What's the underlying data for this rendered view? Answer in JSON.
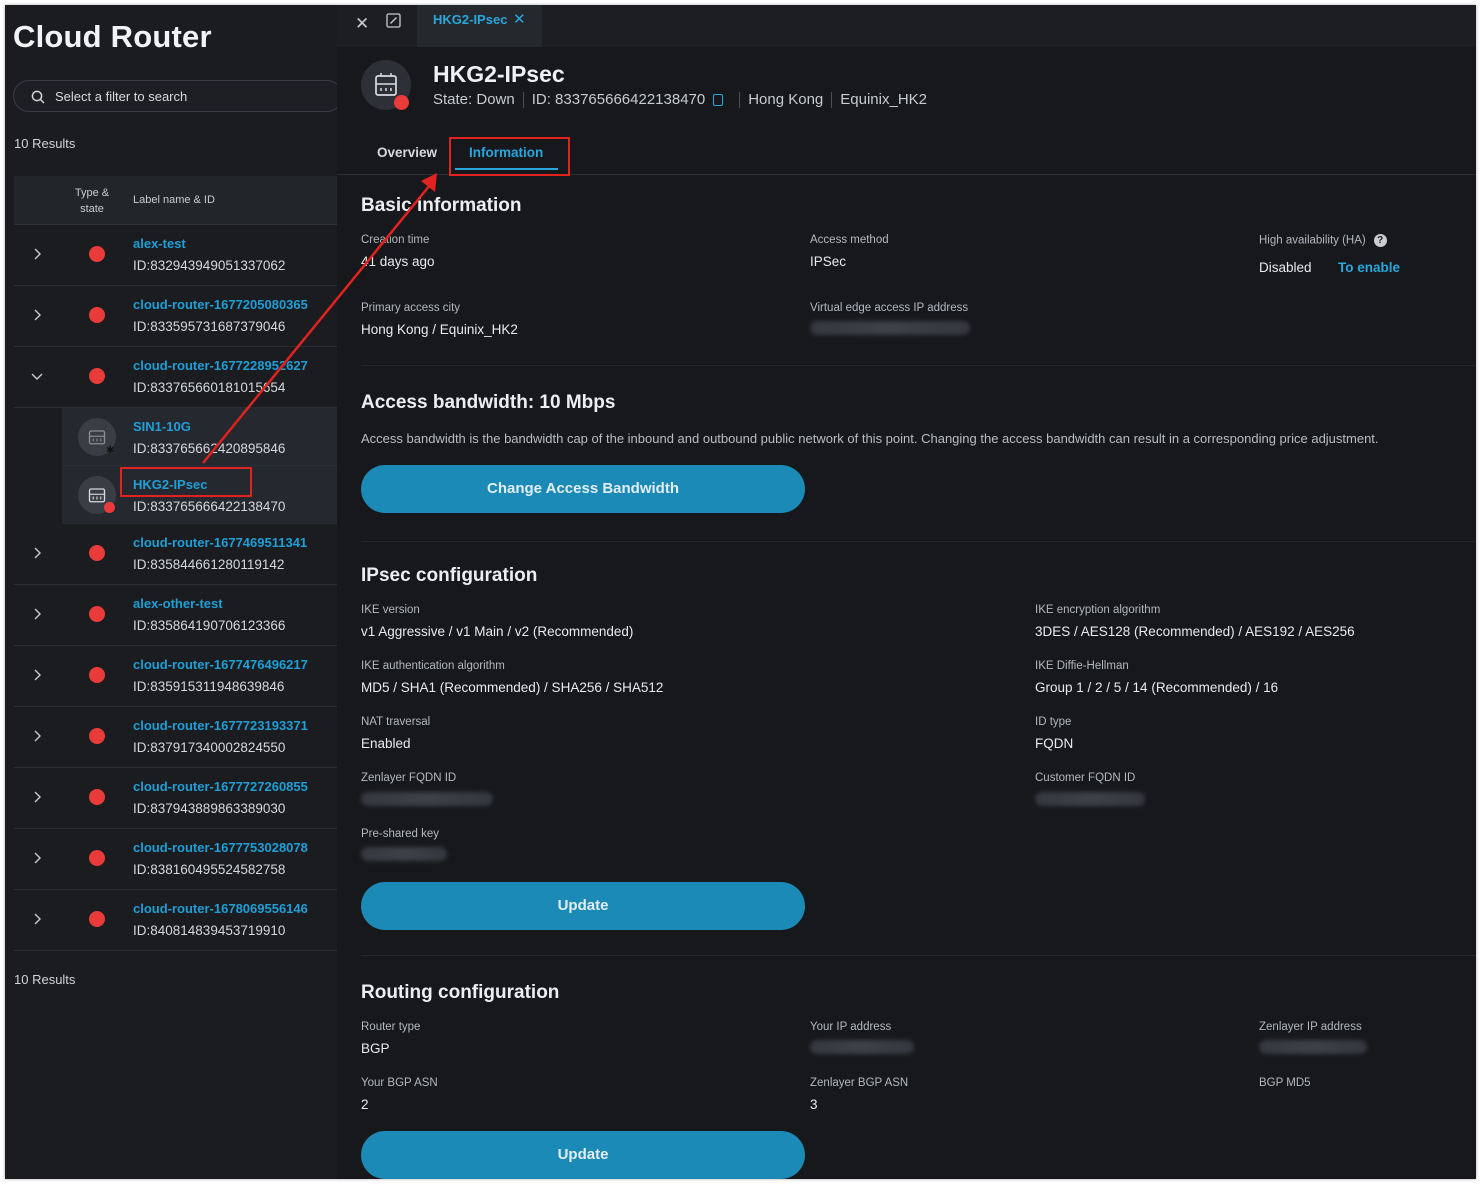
{
  "sidebar": {
    "title": "Cloud Router",
    "search_placeholder": "Select a filter to search",
    "results_top": "10 Results",
    "results_bottom": "10 Results",
    "columns": {
      "type_state": "Type & state",
      "label": "Label name & ID"
    },
    "rows": [
      {
        "name": "alex-test",
        "id": "ID:832943949051337062",
        "state": "down",
        "expanded": false
      },
      {
        "name": "cloud-router-1677205080365",
        "id": "ID:833595731687379046",
        "state": "down",
        "expanded": false
      },
      {
        "name": "cloud-router-1677228952627",
        "id": "ID:833765660181015654",
        "state": "down",
        "expanded": true
      },
      {
        "name": "SIN1-10G",
        "id": "ID:833765662420895846",
        "child": true
      },
      {
        "name": "HKG2-IPsec",
        "id": "ID:833765666422138470",
        "child": true,
        "highlighted": true
      },
      {
        "name": "cloud-router-1677469511341",
        "id": "ID:835844661280119142",
        "state": "down",
        "expanded": false
      },
      {
        "name": "alex-other-test",
        "id": "ID:835864190706123366",
        "state": "down",
        "expanded": false
      },
      {
        "name": "cloud-router-1677476496217",
        "id": "ID:835915311948639846",
        "state": "down",
        "expanded": false
      },
      {
        "name": "cloud-router-1677723193371",
        "id": "ID:837917340002824550",
        "state": "down",
        "expanded": false
      },
      {
        "name": "cloud-router-1677727260855",
        "id": "ID:837943889863389030",
        "state": "down",
        "expanded": false
      },
      {
        "name": "cloud-router-1677753028078",
        "id": "ID:838160495524582758",
        "state": "down",
        "expanded": false
      },
      {
        "name": "cloud-router-1678069556146",
        "id": "ID:840814839453719910",
        "state": "down",
        "expanded": false
      }
    ]
  },
  "tabbar": {
    "tab_label": "HKG2-IPsec"
  },
  "header": {
    "title": "HKG2-IPsec",
    "state": "State: Down",
    "id": "ID: 833765666422138470",
    "city": "Hong Kong",
    "dc": "Equinix_HK2"
  },
  "tabs": {
    "overview": "Overview",
    "information": "Information",
    "active": "information"
  },
  "basic": {
    "title": "Basic information",
    "creation_label": "Creation time",
    "creation_value": "41 days ago",
    "access_method_label": "Access method",
    "access_method_value": "IPSec",
    "ha_label": "High availability (HA)",
    "ha_value": "Disabled",
    "ha_link": "To enable",
    "city_label": "Primary access city",
    "city_value": "Hong Kong / Equinix_HK2",
    "edge_ip_label": "Virtual edge access IP address"
  },
  "bandwidth": {
    "title": "Access bandwidth: 10 Mbps",
    "description": "Access bandwidth is the bandwidth cap of the inbound and outbound public network of this point. Changing the access bandwidth can result in a corresponding price adjustment.",
    "button": "Change Access Bandwidth"
  },
  "ipsec": {
    "title": "IPsec configuration",
    "ike_version_label": "IKE version",
    "ike_version_value": "v1 Aggressive / v1 Main / v2 (Recommended)",
    "ike_enc_label": "IKE encryption algorithm",
    "ike_enc_value": "3DES / AES128 (Recommended) / AES192 / AES256",
    "ike_auth_label": "IKE authentication algorithm",
    "ike_auth_value": "MD5 / SHA1 (Recommended) / SHA256 / SHA512",
    "ike_dh_label": "IKE Diffie-Hellman",
    "ike_dh_value": "Group 1 / 2 / 5 / 14 (Recommended) / 16",
    "nat_label": "NAT traversal",
    "nat_value": "Enabled",
    "id_type_label": "ID type",
    "id_type_value": "FQDN",
    "zen_fqdn_label": "Zenlayer FQDN ID",
    "cust_fqdn_label": "Customer FQDN ID",
    "psk_label": "Pre-shared key",
    "button": "Update"
  },
  "routing": {
    "title": "Routing configuration",
    "router_type_label": "Router type",
    "router_type_value": "BGP",
    "your_ip_label": "Your IP address",
    "zen_ip_label": "Zenlayer IP address",
    "your_asn_label": "Your BGP ASN",
    "your_asn_value": "2",
    "zen_asn_label": "Zenlayer BGP ASN",
    "zen_asn_value": "3",
    "md5_label": "BGP MD5",
    "button": "Update"
  },
  "colors": {
    "accent": "#2aa7dd",
    "alert": "#ea3b3b",
    "annotation": "#e0231f",
    "button": "#1b8ab6"
  }
}
